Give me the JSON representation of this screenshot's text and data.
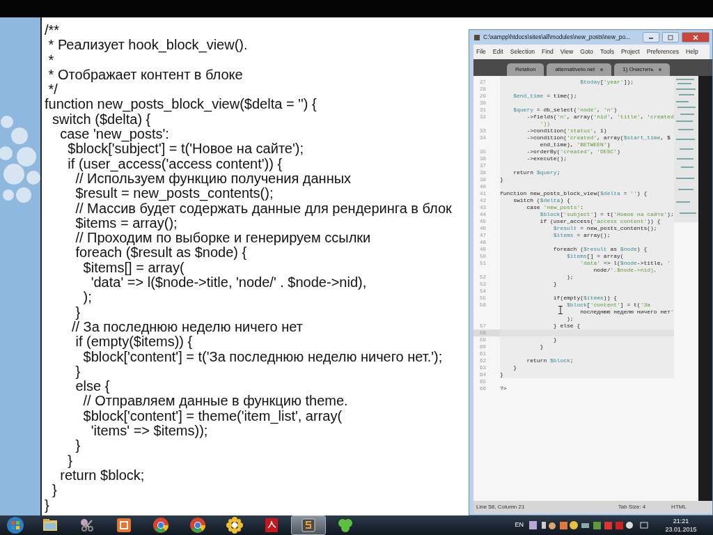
{
  "slide_code": {
    "lines": [
      "/**",
      " * Реализует hook_block_view().",
      " *",
      " * Отображает контент в блоке",
      " */",
      "function new_posts_block_view($delta = '') {",
      "  switch ($delta) {",
      "    case 'new_posts':",
      "      $block['subject'] = t('Новое на сайте');",
      "      if (user_access('access content')) {",
      "        // Используем функцию получения данных",
      "        $result = new_posts_contents();",
      "        // Массив будет содержать данные для рендеринга в блок",
      "        $items = array();",
      "        // Проходим по выборке и генерируем ссылки",
      "        foreach ($result as $node) {",
      "          $items[] = array(",
      "            'data' => l($node->title, 'node/' . $node->nid),",
      "          );",
      "        }",
      "       // За последнюю неделю ничего нет",
      "        if (empty($items)) {",
      "          $block['content'] = t('За последнюю неделю ничего нет.');",
      "        }",
      "        else {",
      "          // Отправляем данные в функцию theme.",
      "          $block['content'] = theme('item_list', array(",
      "            'items' => $items));",
      "        }",
      "      }",
      "    return $block;",
      "  }",
      "}"
    ]
  },
  "editor": {
    "title": "C:\\xampp\\htdocs\\sites\\all\\modules\\new_posts\\new_po...",
    "menu": [
      "File",
      "Edit",
      "Selection",
      "Find",
      "View",
      "Goto",
      "Tools",
      "Project",
      "Preferences",
      "Help"
    ],
    "tabs": [
      {
        "label": "Relation",
        "selected": false,
        "closable": false
      },
      {
        "label": "alternativeto.net",
        "selected": false,
        "closable": true
      },
      {
        "label": "1) Очистить",
        "selected": false,
        "closable": true
      }
    ],
    "rows": [
      {
        "number": "27",
        "text": "                        $today['year']);",
        "selected": false
      },
      {
        "number": "28",
        "selected": false
      },
      {
        "number": "29",
        "text": "    $end_time = time();",
        "selected": false
      },
      {
        "number": "30",
        "selected": false
      },
      {
        "number": "31",
        "text": "    $query = db_select('node', 'n')",
        "selected": false
      },
      {
        "number": "32",
        "text": "        ->fields('n', array('nid', 'title', 'created",
        "selected": false
      },
      {
        "text": "            '))",
        "selected": false
      },
      {
        "number": "33",
        "text": "        ->condition('status', 1)",
        "selected": false
      },
      {
        "number": "34",
        "text": "        ->condition('created', array($start_time, $",
        "selected": false
      },
      {
        "text": "            end_time), 'BETWEEN')",
        "selected": false
      },
      {
        "number": "35",
        "text": "        ->orderBy('created', 'DESC')",
        "selected": false
      },
      {
        "number": "36",
        "text": "        ->execute();",
        "selected": false
      },
      {
        "number": "37",
        "selected": false
      },
      {
        "number": "38",
        "text": "    return $query;",
        "selected": false
      },
      {
        "number": "39",
        "text": "}",
        "selected": false
      },
      {
        "number": "40",
        "selected": false
      },
      {
        "number": "41",
        "text": "function new_posts_block_view($delta = '') {",
        "selected": false
      },
      {
        "number": "42",
        "text": "    switch ($delta) {",
        "selected": false
      },
      {
        "number": "43",
        "text": "        case 'new_posts':",
        "selected": false
      },
      {
        "number": "44",
        "text": "            $block['subject'] = t('Новое на сайте');",
        "selected": false
      },
      {
        "number": "45",
        "text": "            if (user_access('access content')) {",
        "selected": false
      },
      {
        "number": "46",
        "text": "                $result = new_posts_contents();",
        "selected": false
      },
      {
        "number": "47",
        "text": "                $items = array();",
        "selected": false
      },
      {
        "number": "48",
        "selected": false
      },
      {
        "number": "49",
        "text": "                foreach ($result as $node) {",
        "selected": false
      },
      {
        "number": "50",
        "text": "                    $items[] = array(",
        "selected": false
      },
      {
        "number": "51",
        "text": "                        'data' => l($node->title, '",
        "selected": false
      },
      {
        "text": "                            node/'.$node->nid),",
        "selected": false
      },
      {
        "number": "52",
        "text": "                    );",
        "selected": false
      },
      {
        "number": "53",
        "text": "                }",
        "selected": false
      },
      {
        "number": "54",
        "selected": false
      },
      {
        "number": "55",
        "text": "                if(empty($items)) {",
        "selected": false
      },
      {
        "number": "56",
        "text": "                    $block['content'] = t('За",
        "selected": false
      },
      {
        "text": "                        последнюю неделю ничего нет'",
        "selected": false
      },
      {
        "text": "                    );",
        "selected": false
      },
      {
        "number": "57",
        "text": "                } else {",
        "selected": false
      },
      {
        "number": "58",
        "selected": true
      },
      {
        "number": "59",
        "text": "                }",
        "selected": false
      },
      {
        "number": "60",
        "text": "            }",
        "selected": false
      },
      {
        "number": "61",
        "selected": false
      },
      {
        "number": "62",
        "text": "        return $block;",
        "selected": false
      },
      {
        "number": "63",
        "text": "    }",
        "selected": false
      },
      {
        "number": "64",
        "text": "}",
        "selected": false
      },
      {
        "number": "65",
        "selected": false
      },
      {
        "number": "66",
        "text": "?>",
        "selected": false
      }
    ],
    "status_bar": {
      "position": "Line 58, Column 21",
      "tab_size": "Tab Size: 4",
      "syntax": "HTML"
    }
  },
  "taskbar": {
    "apps": [
      {
        "selected": false
      },
      {
        "selected": false
      },
      {
        "selected": false
      },
      {
        "selected": false
      },
      {
        "selected": false
      },
      {
        "selected": false
      },
      {
        "selected": false
      },
      {
        "selected": true
      },
      {
        "selected": false
      }
    ],
    "language": "EN",
    "time": "21:21",
    "date": "23.01.2015"
  }
}
